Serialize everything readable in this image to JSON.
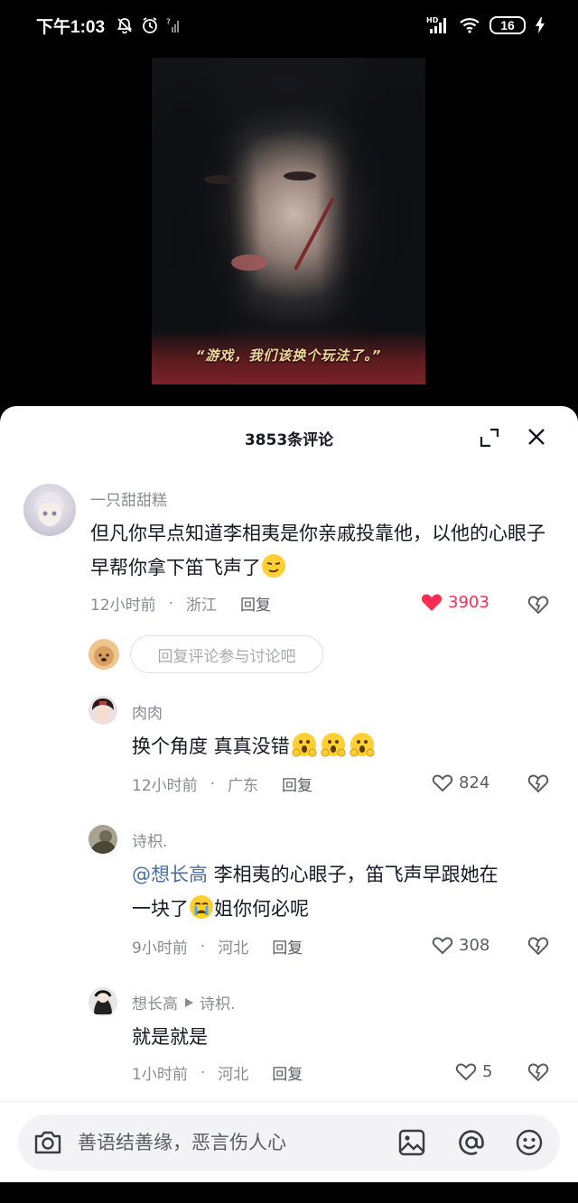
{
  "status_bar": {
    "time": "下午1:03",
    "battery": "16",
    "icons": [
      "silent-bell-icon",
      "alarm-icon",
      "sim-icon",
      "hd-signal-icon",
      "wifi-icon",
      "battery-icon",
      "charging-icon"
    ]
  },
  "video": {
    "subtitle": "“游戏，我们该换个玩法了。”"
  },
  "comments_panel": {
    "title": "3853条评论",
    "comments": [
      {
        "username": "一只甜甜糕",
        "text": "但凡你早点知道李相夷是你亲戚投靠他，以他的心眼子早帮你拿下笛飞声了",
        "time": "12小时前",
        "location": "浙江",
        "reply_label": "回复",
        "likes": "3903",
        "liked": true
      }
    ],
    "reply_prompt": "回复评论参与讨论吧",
    "replies": [
      {
        "username": "肉肉",
        "text": "换个角度 真真没错",
        "time": "12小时前",
        "location": "广东",
        "reply_label": "回复",
        "likes": "824"
      },
      {
        "username": "诗枳.",
        "mention": "@想长高",
        "text_line1": " 李相夷的心眼子，笛飞声早跟她在",
        "text_line2_a": "一块了",
        "text_line2_b": "姐你何必呢",
        "time": "9小时前",
        "location": "河北",
        "reply_label": "回复",
        "likes": "308"
      },
      {
        "username": "想长高",
        "reply_to": "诗枳.",
        "text": "就是就是",
        "time": "1小时前",
        "location": "河北",
        "reply_label": "回复",
        "likes": "5"
      }
    ]
  },
  "input": {
    "placeholder": "善语结善缘，恶言伤人心"
  },
  "colors": {
    "accent_like": "#fe2c55",
    "mention": "#4a6fa5"
  }
}
